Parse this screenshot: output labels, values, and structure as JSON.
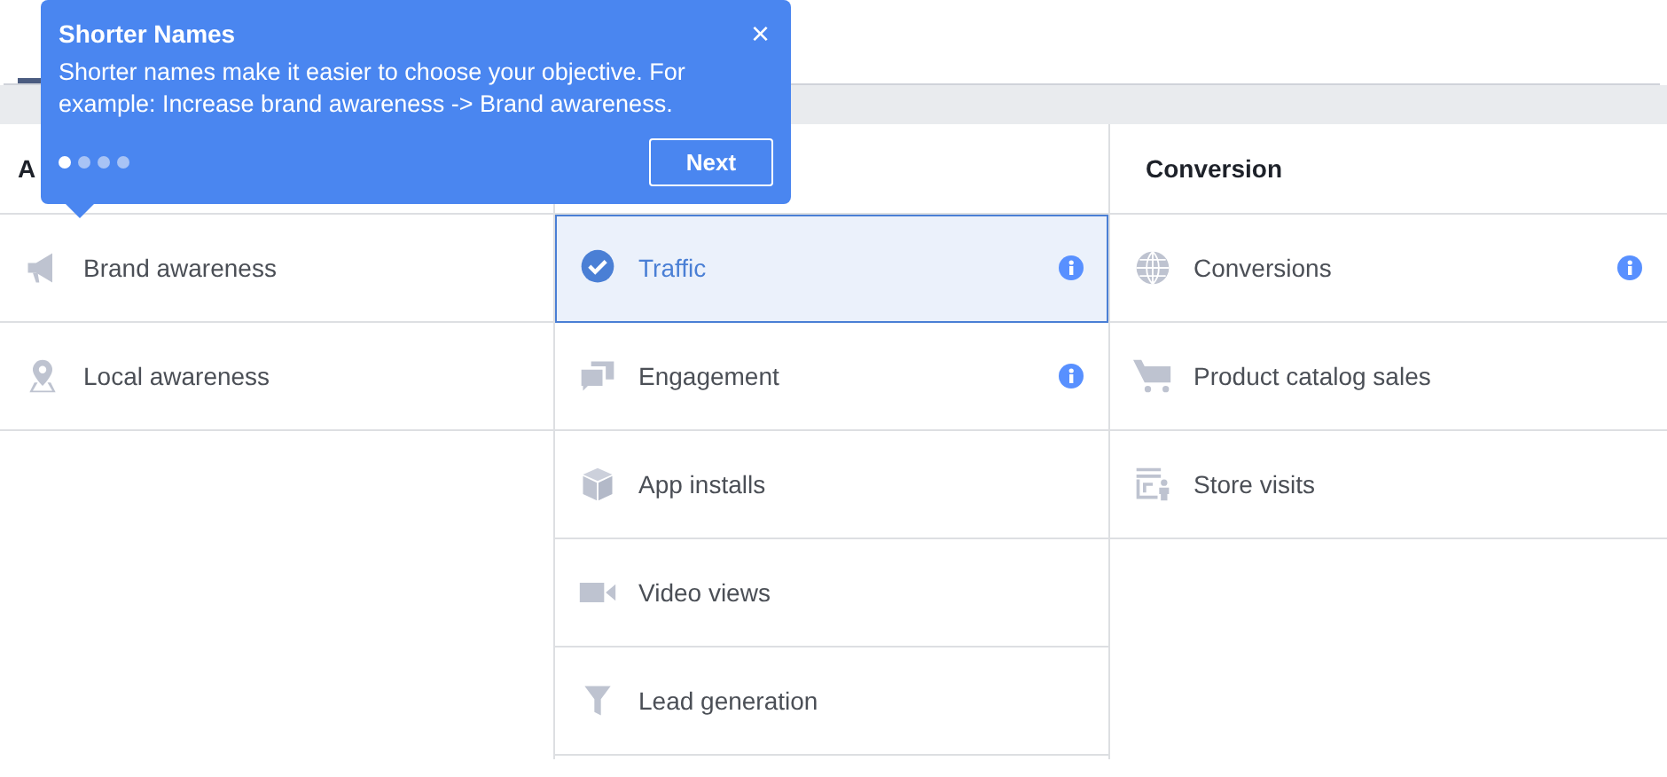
{
  "tooltip": {
    "title": "Shorter Names",
    "text": "Shorter names make it easier to choose your objective. For example: Increase brand awareness -> Brand awareness.",
    "close": "×",
    "next_button": "Next",
    "steps": [
      {
        "selected": true
      },
      {
        "selected": false
      },
      {
        "selected": false
      },
      {
        "selected": false
      }
    ]
  },
  "columns": [
    {
      "header": "A",
      "items": [
        {
          "label": "Brand awareness",
          "kind": "megaphone",
          "info": false,
          "selected": false
        },
        {
          "label": "Local awareness",
          "kind": "pin",
          "info": false,
          "selected": false
        }
      ]
    },
    {
      "items": [
        {
          "label": "Traffic",
          "kind": "check",
          "info": true,
          "selected": true
        },
        {
          "label": "Engagement",
          "kind": "chat",
          "info": true,
          "selected": false
        },
        {
          "label": "App installs",
          "kind": "box",
          "info": false,
          "selected": false
        },
        {
          "label": "Video views",
          "kind": "video",
          "info": false,
          "selected": false
        },
        {
          "label": "Lead generation",
          "kind": "funnel",
          "info": false,
          "selected": false
        }
      ]
    },
    {
      "header": "Conversion",
      "items": [
        {
          "label": "Conversions",
          "kind": "globe",
          "info": true,
          "selected": false
        },
        {
          "label": "Product catalog sales",
          "kind": "cart",
          "info": false,
          "selected": false
        },
        {
          "label": "Store visits",
          "kind": "store",
          "info": false,
          "selected": false
        }
      ]
    }
  ]
}
